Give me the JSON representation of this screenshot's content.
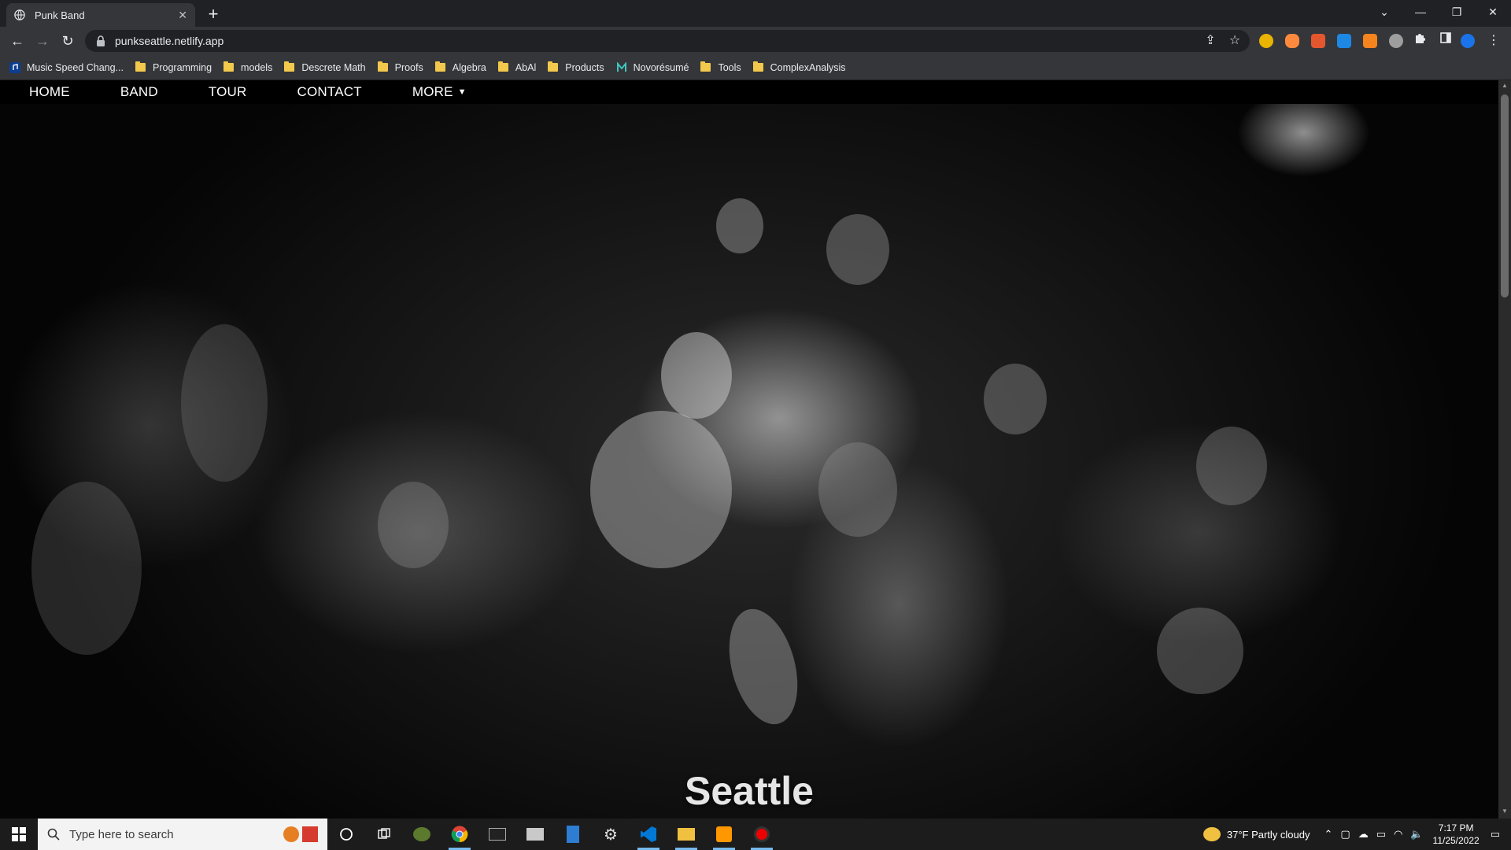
{
  "browser": {
    "tab_title": "Punk Band",
    "tab_close": "✕",
    "new_tab": "+",
    "url": "punkseattle.netlify.app",
    "window_controls": {
      "dropdown": "⌄",
      "minimize": "—",
      "restore": "❐",
      "close": "✕"
    },
    "nav": {
      "back": "←",
      "forward": "→",
      "reload": "↻"
    },
    "omni_actions": {
      "share": "⇪",
      "bookmark": "☆"
    }
  },
  "bookmarks": [
    {
      "label": "Music Speed Chang...",
      "icon": "music-icon"
    },
    {
      "label": "Programming",
      "icon": "folder-icon"
    },
    {
      "label": "models",
      "icon": "folder-icon"
    },
    {
      "label": "Descrete Math",
      "icon": "folder-icon"
    },
    {
      "label": "Proofs",
      "icon": "folder-icon"
    },
    {
      "label": "Algebra",
      "icon": "folder-icon"
    },
    {
      "label": "AbAl",
      "icon": "folder-icon"
    },
    {
      "label": "Products",
      "icon": "folder-icon"
    },
    {
      "label": "Novorésumé",
      "icon": "novoresume-icon"
    },
    {
      "label": "Tools",
      "icon": "folder-icon"
    },
    {
      "label": "ComplexAnalysis",
      "icon": "folder-icon"
    }
  ],
  "site": {
    "nav": {
      "home": "HOME",
      "band": "BAND",
      "tour": "TOUR",
      "contact": "CONTACT",
      "more": "MORE"
    },
    "hero_title": "Seattle"
  },
  "taskbar": {
    "search_placeholder": "Type here to search",
    "weather": "37°F  Partly cloudy",
    "time": "7:17 PM",
    "date": "11/25/2022"
  },
  "colors": {
    "chrome_dark": "#202124",
    "chrome_toolbar": "#35363a",
    "site_nav_bg": "#000000",
    "folder": "#f2c94c",
    "taskbar_bg": "#1c1c1c"
  }
}
